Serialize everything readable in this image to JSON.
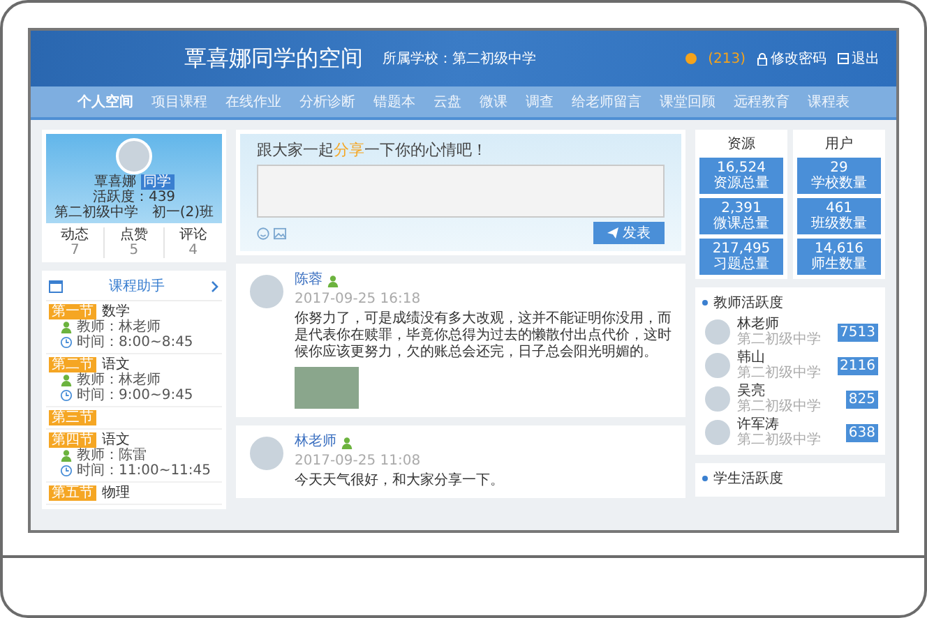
{
  "header": {
    "title": "覃喜娜同学的空间",
    "school": "所属学校：第二初级中学",
    "coins": "(213)",
    "change_password": "修改密码",
    "logout": "退出"
  },
  "nav": [
    {
      "label": "个人空间",
      "selected": true
    },
    {
      "label": "项目课程",
      "selected": false
    },
    {
      "label": "在线作业",
      "selected": false
    },
    {
      "label": "分析诊断",
      "selected": false
    },
    {
      "label": "错题本",
      "selected": false
    },
    {
      "label": "云盘",
      "selected": false
    },
    {
      "label": "微课",
      "selected": false
    },
    {
      "label": "调查",
      "selected": false
    },
    {
      "label": "给老师留言",
      "selected": false
    },
    {
      "label": "课堂回顾",
      "selected": false
    },
    {
      "label": "远程教育",
      "selected": false
    },
    {
      "label": "课程表",
      "selected": false
    }
  ],
  "profile": {
    "name": "覃喜娜",
    "role": "同学",
    "activity": "活跃度：439",
    "class": "第二初级中学　初一(2)班",
    "stats": [
      {
        "label": "动态",
        "value": "7"
      },
      {
        "label": "点赞",
        "value": "5"
      },
      {
        "label": "评论",
        "value": "4"
      }
    ]
  },
  "course_helper": {
    "title": "课程助手",
    "lessons": [
      {
        "period": "第一节",
        "subject": "数学",
        "teacher": "教师：林老师",
        "time": "时间：8:00~8:45"
      },
      {
        "period": "第二节",
        "subject": "语文",
        "teacher": "教师：林老师",
        "time": "时间：9:00~9:45"
      },
      {
        "period": "第三节"
      },
      {
        "period": "第四节",
        "subject": "语文",
        "teacher": "教师：陈雷",
        "time": "时间：11:00~11:45"
      },
      {
        "period": "第五节",
        "subject": "物理"
      }
    ]
  },
  "mood_box": {
    "prompt_before": "跟大家一起",
    "prompt_highlight": "分享",
    "prompt_after": "一下你的心情吧！",
    "submit": "发表"
  },
  "posts": [
    {
      "author": "陈蓉",
      "date": "2017-09-25 16:18",
      "text": "你努力了，可是成绩没有多大改观，这并不能证明你没用，而是代表你在赎罪，毕竟你总得为过去的懒散付出点代价，这时候你应该更努力，欠的账总会还完，日子总会阳光明媚的。",
      "has_photo": true
    },
    {
      "author": "林老师",
      "date": "2017-09-25 11:08",
      "text": "今天天气很好，和大家分享一下。",
      "has_photo": false
    }
  ],
  "stats": [
    {
      "title": "资源",
      "items": [
        {
          "value": "16,524",
          "label": "资源总量"
        },
        {
          "value": "2,391",
          "label": "微课总量"
        },
        {
          "value": "217,495",
          "label": "习题总量"
        }
      ]
    },
    {
      "title": "用户",
      "items": [
        {
          "value": "29",
          "label": "学校数量"
        },
        {
          "value": "461",
          "label": "班级数量"
        },
        {
          "value": "14,616",
          "label": "师生数量"
        }
      ]
    }
  ],
  "teacher_activity": {
    "title": "教师活跃度",
    "teachers": [
      {
        "name": "林老师",
        "school": "第二初级中学",
        "score": "7513"
      },
      {
        "name": "韩山",
        "school": "第二初级中学",
        "score": "2116"
      },
      {
        "name": "吴亮",
        "school": "第二初级中学",
        "score": "825"
      },
      {
        "name": "许军涛",
        "school": "第二初级中学",
        "score": "638"
      }
    ]
  },
  "student_activity": {
    "title": "学生活跃度"
  }
}
